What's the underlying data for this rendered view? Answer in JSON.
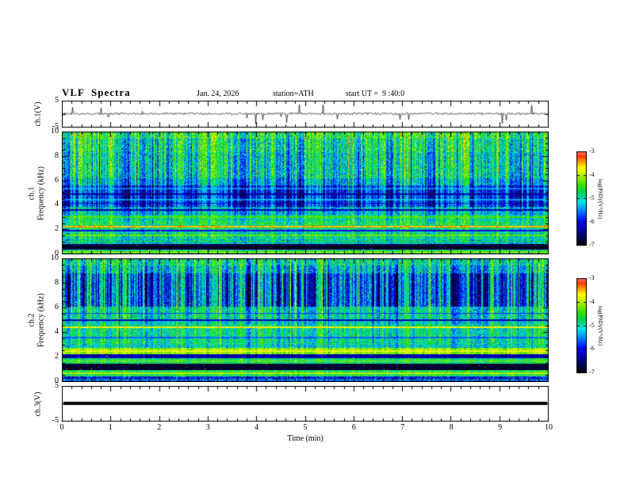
{
  "header": {
    "title": "VLF  Spectra",
    "date": "Jan. 24, 2026",
    "station": "station=ATH",
    "start_ut": "start UT =  9 :40:0"
  },
  "axes": {
    "x": {
      "label": "Time (min)",
      "min": 0,
      "max": 10,
      "tick_labels": [
        "0",
        "1",
        "2",
        "3",
        "4",
        "5",
        "6",
        "7",
        "8",
        "9",
        "10"
      ]
    }
  },
  "colorbar": {
    "label": "log(PSD)/(V²/Hz)",
    "min": -7,
    "max": -3,
    "tick_labels": [
      "-3",
      "-4",
      "-5",
      "-6",
      "-7"
    ]
  },
  "colormap_stops": [
    {
      "p": 0.0,
      "c": "#000000"
    },
    {
      "p": 0.07,
      "c": "#000046"
    },
    {
      "p": 0.16,
      "c": "#0000a0"
    },
    {
      "p": 0.27,
      "c": "#0010ff"
    },
    {
      "p": 0.38,
      "c": "#0090ff"
    },
    {
      "p": 0.47,
      "c": "#00e8e8"
    },
    {
      "p": 0.56,
      "c": "#00d050"
    },
    {
      "p": 0.64,
      "c": "#30e000"
    },
    {
      "p": 0.74,
      "c": "#b0f000"
    },
    {
      "p": 0.83,
      "c": "#ffff00"
    },
    {
      "p": 0.9,
      "c": "#ff9000"
    },
    {
      "p": 0.95,
      "c": "#ff3800"
    },
    {
      "p": 1.0,
      "c": "#ff8080"
    }
  ],
  "chart_data": [
    {
      "type": "line",
      "id": "ch1-waveform",
      "ylabel": "ch.1(V)",
      "ylim": [
        -5,
        5
      ],
      "yticks": [
        5,
        -5
      ],
      "ytick_labels": [
        "5",
        "-5"
      ],
      "seed": 77,
      "noise_amp": 0.4,
      "spike_prob": 0.028,
      "spike_max": 4.2,
      "description": "noisy voltage trace around 0 V with many narrow impulsive spikes up to about +/-4 V"
    },
    {
      "type": "heatmap",
      "id": "ch1-spectrogram",
      "ylabel_top": "ch.1",
      "ylabel_bottom": "Frequency (kHz)",
      "ylim": [
        0,
        10
      ],
      "yticks": [
        0,
        2,
        4,
        6,
        8,
        10
      ],
      "ytick_labels": [
        "0",
        "2",
        "4",
        "6",
        "8",
        "10"
      ],
      "xlim": [
        0,
        10
      ],
      "value_range": [
        -7,
        -3
      ],
      "seed": 99,
      "speckle": 0.004,
      "bands": [
        {
          "f0": 9.4,
          "f1": 10.01,
          "base": 0.6,
          "noise": 0.17,
          "streak": 0.25
        },
        {
          "f0": 8.3,
          "f1": 9.4,
          "base": 0.54,
          "noise": 0.16,
          "streak": 0.3
        },
        {
          "f0": 6.2,
          "f1": 8.3,
          "base": 0.5,
          "noise": 0.15,
          "streak": 0.32
        },
        {
          "f0": 5.6,
          "f1": 6.2,
          "base": 0.42,
          "noise": 0.12,
          "streak": 0.3
        },
        {
          "f0": 3.9,
          "f1": 5.6,
          "base": 0.29,
          "noise": 0.1,
          "streak": 0.3
        },
        {
          "f0": 3.2,
          "f1": 3.9,
          "base": 0.44,
          "noise": 0.12,
          "streak": 0.24
        },
        {
          "f0": 2.7,
          "f1": 3.2,
          "base": 0.52,
          "noise": 0.12,
          "streak": 0.2
        },
        {
          "f0": 2.05,
          "f1": 2.7,
          "base": 0.56,
          "noise": 0.13,
          "streak": 0.18
        },
        {
          "f0": 1.25,
          "f1": 2.05,
          "base": 0.52,
          "noise": 0.15,
          "streak": 0.16
        },
        {
          "f0": 0.85,
          "f1": 1.25,
          "base": 0.46,
          "noise": 0.14,
          "streak": 0.12
        },
        {
          "f0": 0.38,
          "f1": 0.85,
          "base": 0.07,
          "noise": 0.05,
          "streak": 0.04
        },
        {
          "f0": 0.0,
          "f1": 0.38,
          "base": 0.55,
          "noise": 0.18,
          "streak": 0.08
        }
      ],
      "hlines": [
        {
          "f": 5.35,
          "v": 0.4,
          "w": 0.06
        },
        {
          "f": 4.9,
          "v": 0.16,
          "w": 0.05
        },
        {
          "f": 4.45,
          "v": 0.42,
          "w": 0.05
        },
        {
          "f": 4.15,
          "v": 0.2,
          "w": 0.04
        },
        {
          "f": 3.62,
          "v": 0.18,
          "w": 0.05
        },
        {
          "f": 3.05,
          "v": 0.66,
          "w": 0.05
        },
        {
          "f": 2.25,
          "v": 0.88,
          "w": 0.08
        },
        {
          "f": 1.95,
          "v": 0.24,
          "w": 0.05
        },
        {
          "f": 1.55,
          "v": 0.68,
          "w": 0.05
        },
        {
          "f": 1.05,
          "v": 0.62,
          "w": 0.05
        },
        {
          "f": 0.6,
          "v": 0.02,
          "w": 0.07
        },
        {
          "f": 0.18,
          "v": 0.7,
          "w": 0.05
        }
      ],
      "description": "green/cyan spectrogram, dark blue trough 4-6 kHz, vertical impulsive streaks, red-orange line near 2.2 kHz, black band near 0.4-0.8 kHz"
    },
    {
      "type": "heatmap",
      "id": "ch2-spectrogram",
      "ylabel_top": "ch.2",
      "ylabel_bottom": "Frequency (kHz)",
      "ylim": [
        0,
        10
      ],
      "yticks": [
        0,
        2,
        4,
        6,
        8,
        10
      ],
      "ytick_labels": [
        "0",
        "2",
        "4",
        "6",
        "8",
        "10"
      ],
      "xlim": [
        0,
        10
      ],
      "value_range": [
        -7,
        -3
      ],
      "seed": 314,
      "speckle": 0.006,
      "bands": [
        {
          "f0": 9.4,
          "f1": 10.01,
          "base": 0.52,
          "noise": 0.15,
          "streak": 0.22
        },
        {
          "f0": 8.8,
          "f1": 9.4,
          "base": 0.45,
          "noise": 0.14,
          "streak": 0.3
        },
        {
          "f0": 6.1,
          "f1": 8.8,
          "base": 0.33,
          "noise": 0.12,
          "streak": 0.42
        },
        {
          "f0": 5.15,
          "f1": 6.1,
          "base": 0.5,
          "noise": 0.13,
          "streak": 0.25
        },
        {
          "f0": 4.65,
          "f1": 5.15,
          "base": 0.47,
          "noise": 0.12,
          "streak": 0.2
        },
        {
          "f0": 3.0,
          "f1": 4.65,
          "base": 0.52,
          "noise": 0.13,
          "streak": 0.18
        },
        {
          "f0": 2.75,
          "f1": 3.0,
          "base": 0.47,
          "noise": 0.12,
          "streak": 0.15
        },
        {
          "f0": 2.25,
          "f1": 2.75,
          "base": 0.72,
          "noise": 0.09,
          "streak": 0.1
        },
        {
          "f0": 1.95,
          "f1": 2.25,
          "base": 0.18,
          "noise": 0.09,
          "streak": 0.06
        },
        {
          "f0": 1.45,
          "f1": 1.95,
          "base": 0.56,
          "noise": 0.13,
          "streak": 0.1
        },
        {
          "f0": 0.95,
          "f1": 1.45,
          "base": 0.05,
          "noise": 0.04,
          "streak": 0.02
        },
        {
          "f0": 0.45,
          "f1": 0.95,
          "base": 0.58,
          "noise": 0.14,
          "streak": 0.08
        },
        {
          "f0": 0.0,
          "f1": 0.45,
          "base": 0.25,
          "noise": 0.16,
          "streak": 0.06
        }
      ],
      "hlines": [
        {
          "f": 5.55,
          "v": 0.3,
          "w": 0.05
        },
        {
          "f": 5.0,
          "v": 0.18,
          "w": 0.05
        },
        {
          "f": 4.45,
          "v": 0.82,
          "w": 0.06
        },
        {
          "f": 3.6,
          "v": 0.34,
          "w": 0.05
        },
        {
          "f": 2.5,
          "v": 0.8,
          "w": 0.06
        },
        {
          "f": 1.7,
          "v": 0.7,
          "w": 0.05
        },
        {
          "f": 0.7,
          "v": 0.74,
          "w": 0.05
        },
        {
          "f": 0.18,
          "v": 0.45,
          "w": 0.04
        }
      ],
      "description": "blue-dominated 6-9 kHz with dense vertical streaks, green below, bright yellow band near 2.5 kHz, orange line near 4.45 kHz, black bands near 1.2 and 2.1 kHz"
    },
    {
      "type": "flatline",
      "id": "ch3-waveform",
      "ylabel": "ch.3(V)",
      "ylim": [
        -5,
        5
      ],
      "yticks": [
        5,
        -5
      ],
      "ytick_labels": [
        "5",
        "-5"
      ],
      "value": 0,
      "thickness": 4,
      "description": "flat thick black line at 0 V (no signal on channel 3)"
    }
  ]
}
